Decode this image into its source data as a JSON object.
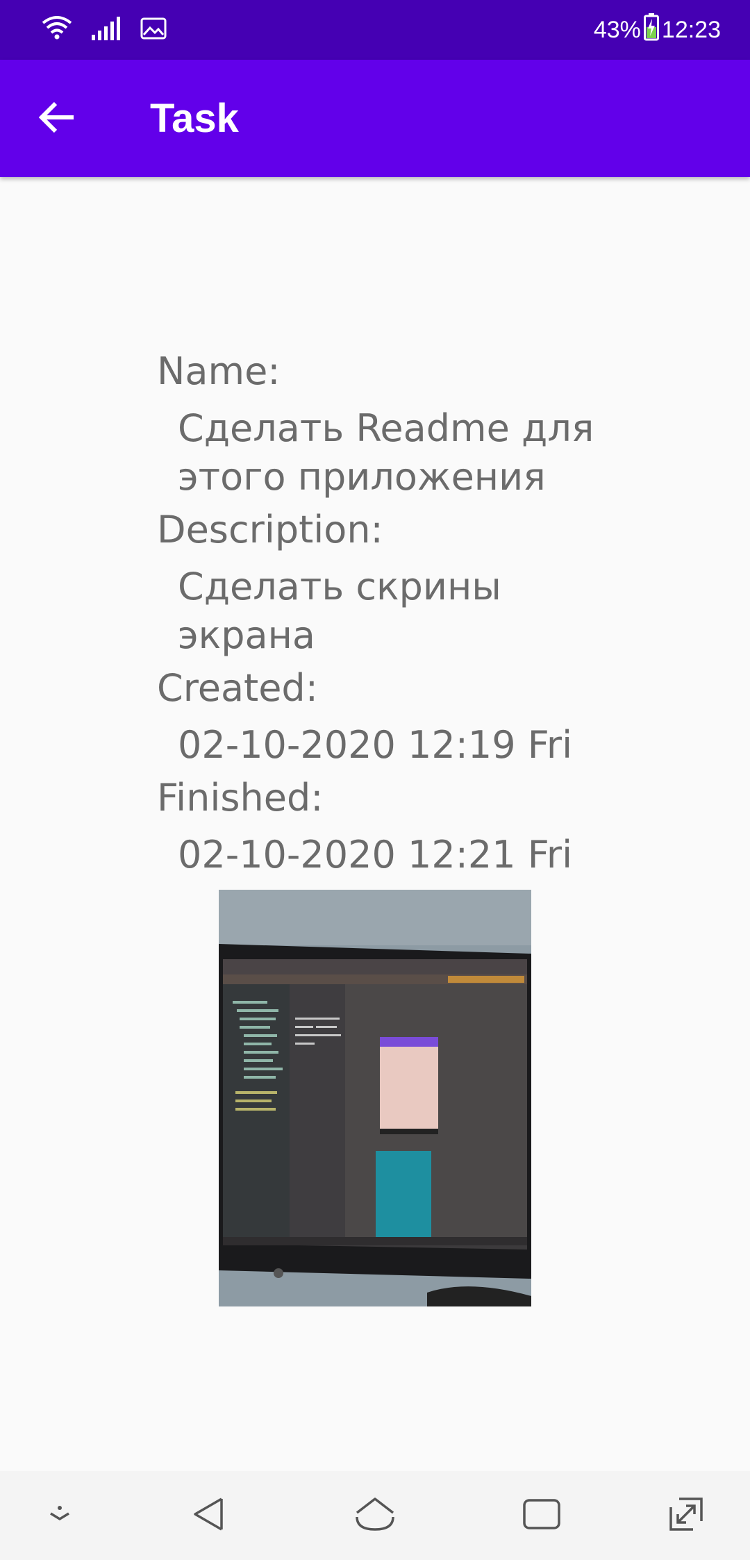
{
  "status_bar": {
    "battery": "43%",
    "time": "12:23",
    "icons": [
      "wifi-icon",
      "signal-icon",
      "image-notification-icon",
      "battery-charging-icon"
    ]
  },
  "app_bar": {
    "title": "Task",
    "back_icon": "arrow-back-icon"
  },
  "task": {
    "name_label": "Name:",
    "name_value_line1": "Сделать Readme для",
    "name_value_line2": "этого приложения",
    "description_label": "Description:",
    "description_value_line1": "Сделать скрины",
    "description_value_line2": "экрана",
    "created_label": "Created:",
    "created_value": "02-10-2020 12:19 Fri",
    "finished_label": "Finished:",
    "finished_value": "02-10-2020 12:21 Fri"
  },
  "nav_bar": {
    "icons": [
      "hide-nav-icon",
      "back-nav-icon",
      "home-nav-icon",
      "recents-nav-icon",
      "screen-resize-icon"
    ]
  },
  "colors": {
    "status_bar": "#4500b3",
    "app_bar": "#6200ea",
    "text": "#6b6b6b",
    "background": "#fafafa"
  }
}
